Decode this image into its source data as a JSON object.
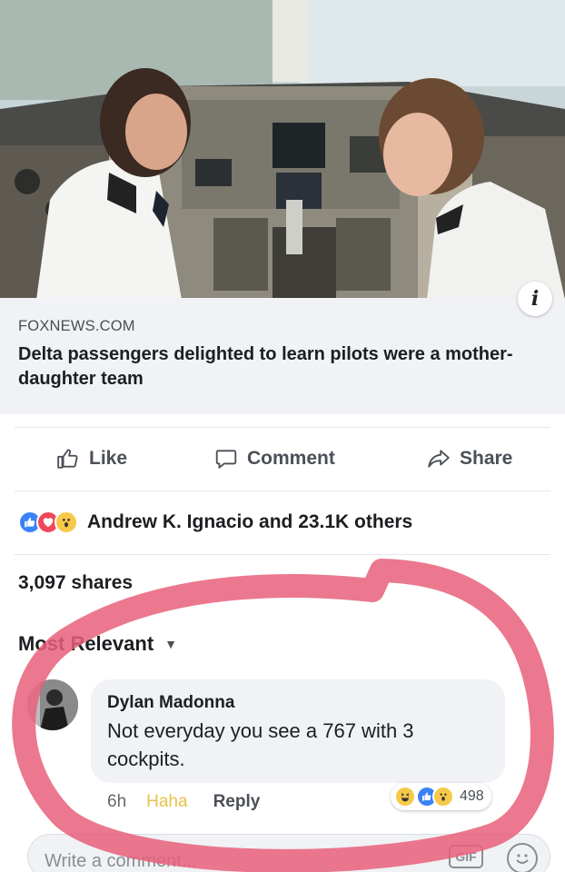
{
  "link": {
    "domain": "FOXNEWS.COM",
    "title": "Delta passengers delighted to learn pilots were a mother-daughter team"
  },
  "actions": {
    "like": "Like",
    "comment": "Comment",
    "share": "Share"
  },
  "reactions": {
    "icons": [
      "like-icon",
      "love-icon",
      "wow-icon"
    ],
    "summary": "Andrew K. Ignacio and 23.1K others"
  },
  "shares": "3,097 shares",
  "sort": {
    "label": "Most Relevant"
  },
  "comment": {
    "author": "Dylan Madonna",
    "text": "Not everyday you see a 767 with 3 cockpits.",
    "time": "6h",
    "haha": "Haha",
    "reply": "Reply",
    "reaction_count": "498",
    "reaction_icons": [
      "haha-icon",
      "like-icon",
      "wow-icon"
    ]
  },
  "composer": {
    "placeholder": "Write a comment...",
    "gif": "GIF"
  },
  "colors": {
    "like_blue": "#3b82f6",
    "love_red": "#f0485a",
    "wow_yellow": "#f7c948",
    "marker_pink": "#e8607a"
  }
}
